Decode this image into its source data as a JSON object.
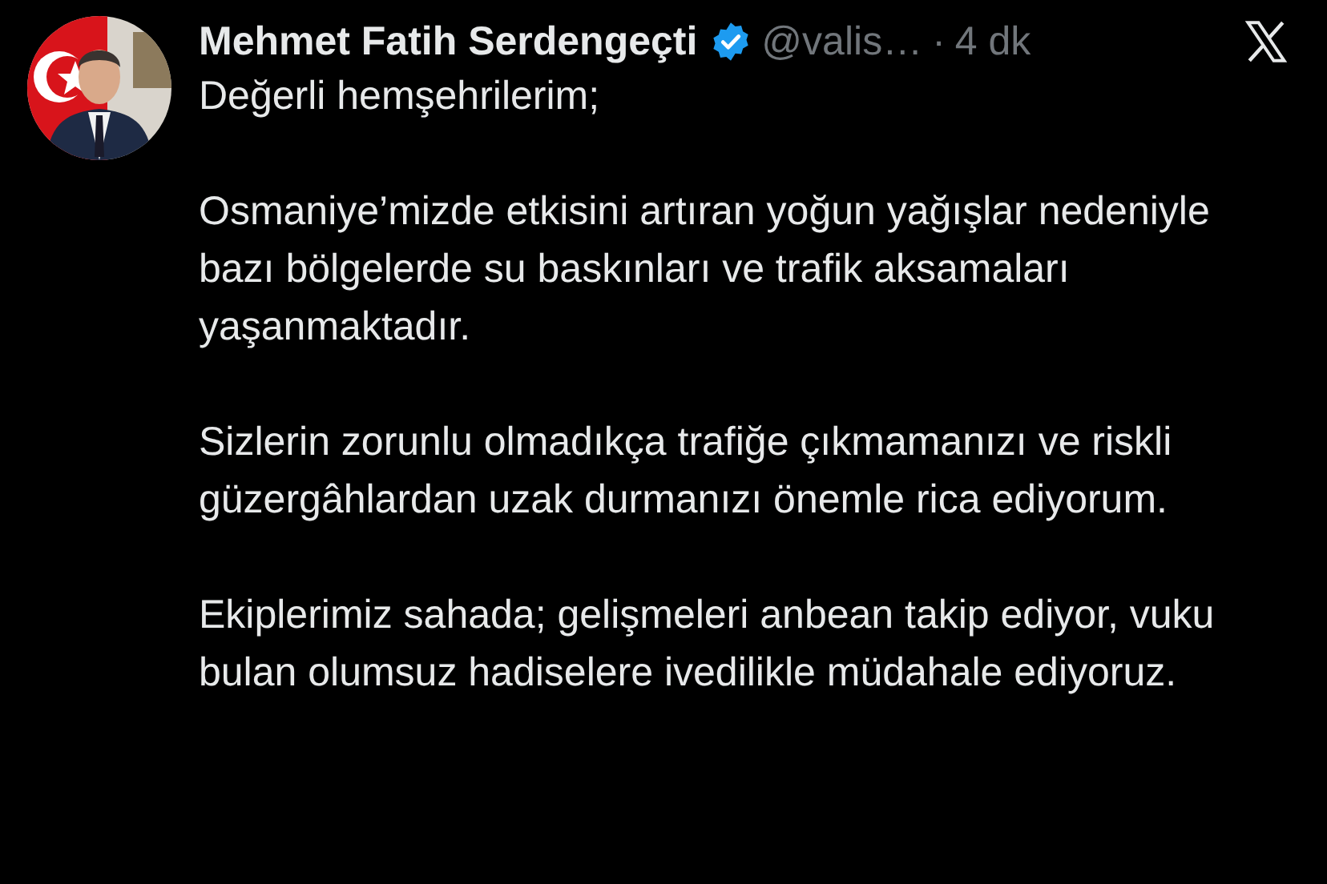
{
  "post": {
    "author": {
      "name": "Mehmet Fatih Serdengeçti",
      "verified": true,
      "handle": "@valis…",
      "separator": "·",
      "time": "4 dk"
    },
    "paragraphs": [
      "Değerli hemşehrilerim;",
      "Osmaniye’mizde etkisini artıran yoğun yağışlar nedeniyle bazı bölgelerde su baskınları ve trafik aksamaları yaşanmaktadır.",
      "Sizlerin zorunlu olmadıkça trafiğe çıkmamanızı ve riskli güzergâhlardan uzak durmanızı önemle rica ediyorum.",
      "Ekiplerimiz sahada; gelişmeleri anbean takip ediyor, vuku bulan olumsuz hadiselere ivedilikle müdahale ediyoruz."
    ]
  }
}
